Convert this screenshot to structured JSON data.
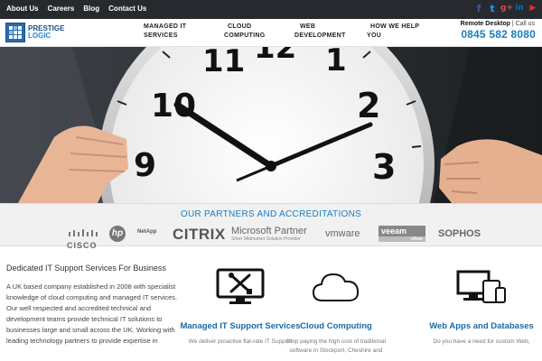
{
  "topbar": {
    "links": [
      "About Us",
      "Careers",
      "Blog",
      "Contact Us"
    ],
    "social": [
      {
        "icon": "facebook-icon",
        "glyph": "f",
        "color": "#3b5998"
      },
      {
        "icon": "twitter-icon",
        "glyph": "t",
        "color": "#1da1f2"
      },
      {
        "icon": "google-plus-icon",
        "glyph": "g+",
        "color": "#dd4b39"
      },
      {
        "icon": "linkedin-icon",
        "glyph": "in",
        "color": "#0077b5"
      },
      {
        "icon": "youtube-icon",
        "glyph": "▶",
        "color": "#e52d27"
      }
    ]
  },
  "header": {
    "logo": {
      "line1": "PRESTIGE",
      "line2": "LOGIC"
    },
    "nav": [
      {
        "w1": "MANAGED IT",
        "w2": "SERVICES"
      },
      {
        "w1": "CLOUD",
        "w2": "COMPUTING"
      },
      {
        "w1": "WEB",
        "w2": "DEVELOPMENT"
      },
      {
        "w1": "HOW WE HELP",
        "w2": "YOU"
      }
    ],
    "remote_desktop": "Remote Desktop",
    "call_us": "| Call us",
    "phone": "0845 582 8080"
  },
  "hero": {
    "clock_numbers": [
      "10",
      "11",
      "12",
      "1",
      "2",
      "3",
      "9"
    ]
  },
  "partners": {
    "title": "OUR PARTNERS AND ACCREDITATIONS",
    "logos": [
      "CISCO",
      "hp",
      "NetApp",
      "CITRIX",
      "Microsoft Partner",
      "Silver Midmarket Solution Provider",
      "vmware",
      "veeam",
      "silver",
      "SOPHOS"
    ]
  },
  "intro": {
    "title": "Dedicated IT Support Services For Business",
    "text": "A UK based company established in 2008 with specialist knowledge of cloud computing and managed IT services. Our well respected and accredited technical and development teams provide technical IT solutions to businesses large and small across the UK. Working with leading technology partners to provide expertise in"
  },
  "services": [
    {
      "title": "Managed IT Support Services",
      "text": "We deliver proactive flat-rate IT Support",
      "icon": "tools-monitor-icon"
    },
    {
      "title": "Cloud Computing",
      "text": "Stop paying the high cost of traditional software in Stockport, Cheshire and",
      "icon": "cloud-icon"
    },
    {
      "title": "Web Apps and Databases",
      "text": "Do you have a need for custom Web,",
      "icon": "devices-icon"
    }
  ],
  "colors": {
    "accent": "#1a7dc1",
    "topbar": "#262a2f",
    "heading": "#1a6aa6"
  }
}
